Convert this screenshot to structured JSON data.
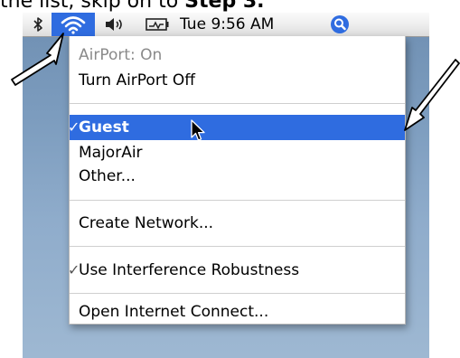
{
  "instruction": {
    "text": "the list, skip on to",
    "bold": "Step 3."
  },
  "menubar": {
    "bluetooth_icon": "bluetooth-icon",
    "airport_icon": "airport-wifi-icon",
    "volume_icon": "volume-icon",
    "battery_icon": "battery-icon",
    "clock": "Tue 9:56 AM",
    "spotlight_icon": "spotlight-search-icon",
    "accent": "#2f6ce0"
  },
  "menu": {
    "status": "AirPort: On",
    "turn_off": "Turn AirPort Off",
    "networks": [
      {
        "label": "Guest",
        "checked": true,
        "selected": true
      },
      {
        "label": "MajorAir",
        "checked": false,
        "selected": false
      },
      {
        "label": "Other...",
        "checked": false,
        "selected": false
      }
    ],
    "create_network": "Create Network...",
    "interference": {
      "label": "Use Interference Robustness",
      "checked": true
    },
    "open_internet_connect": "Open Internet Connect...",
    "checkmark": "✓"
  }
}
